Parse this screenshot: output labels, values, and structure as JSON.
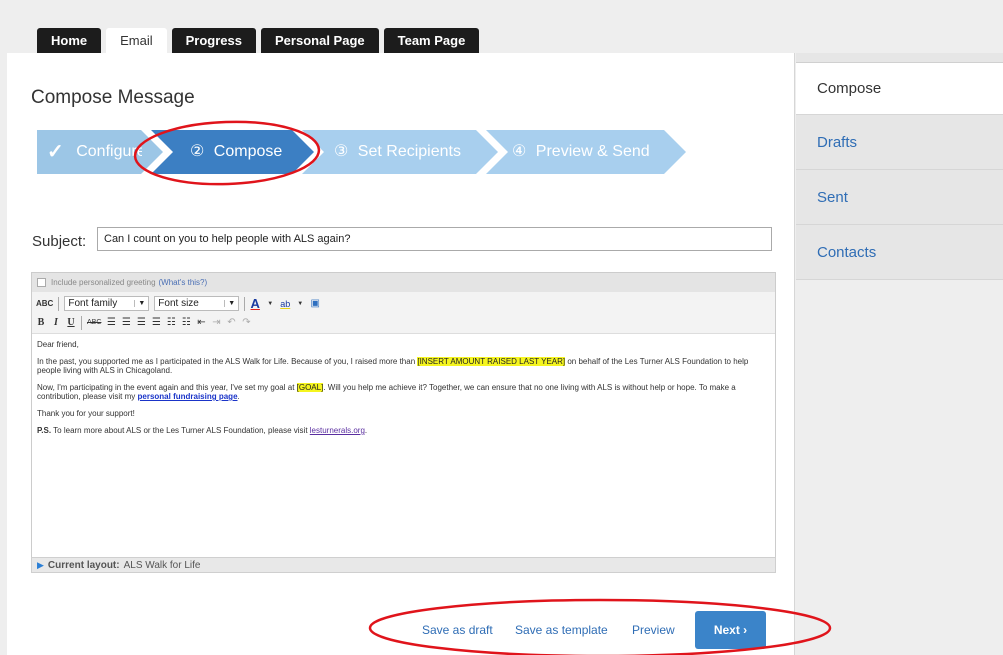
{
  "tabs": [
    {
      "label": "Home",
      "active": false
    },
    {
      "label": "Email",
      "active": true
    },
    {
      "label": "Progress",
      "active": false
    },
    {
      "label": "Personal Page",
      "active": false
    },
    {
      "label": "Team Page",
      "active": false
    }
  ],
  "main": {
    "title": "Compose Message",
    "steps": [
      {
        "label": "Configure",
        "marker": "✓",
        "state": "done"
      },
      {
        "label": "Compose",
        "marker": "②",
        "state": "current"
      },
      {
        "label": "Set Recipients",
        "marker": "③",
        "state": "upcoming"
      },
      {
        "label": "Preview & Send",
        "marker": "④",
        "state": "upcoming"
      }
    ],
    "subject_label": "Subject:",
    "subject_value": "Can I count on you to help people with ALS again?"
  },
  "editor": {
    "greeting_label": "Include personalized greeting",
    "greeting_link": "(What's this?)",
    "toolbar": {
      "font_family": "Font family",
      "font_size": "Font size"
    },
    "body": {
      "salutation": "Dear friend,",
      "p1_a": "In the past, you supported me as I participated in the ALS Walk for Life. Because of you, I raised more than ",
      "p1_highlight": "[INSERT AMOUNT RAISED LAST YEAR]",
      "p1_b": " on behalf of the Les Turner ALS Foundation to help people living with ALS in Chicagoland.",
      "p2_a": "Now, I'm participating in the event again and this year, I've set my goal at ",
      "p2_highlight": "[GOAL]",
      "p2_b": ". Will you help me achieve it? Together, we can ensure that no one living with ALS is without help or hope. To make a contribution, please visit my ",
      "p2_link": "personal fundraising page",
      "p2_c": ".",
      "thanks": "Thank you for your support!",
      "ps_label": "P.S.",
      "ps_text": " To learn more about ALS or the Les Turner ALS Foundation, please visit ",
      "ps_link": "lesturnerals.org",
      "ps_end": "."
    },
    "layout_label": "Current layout:",
    "layout_value": "ALS Walk for Life"
  },
  "actions": {
    "save_draft": "Save as draft",
    "save_template": "Save as template",
    "preview": "Preview",
    "next": "Next ›"
  },
  "sidebar": {
    "items": [
      {
        "label": "Compose",
        "active": true
      },
      {
        "label": "Drafts",
        "active": false
      },
      {
        "label": "Sent",
        "active": false
      },
      {
        "label": "Contacts",
        "active": false
      }
    ]
  },
  "colors": {
    "step_done": "#9cc6e6",
    "step_current": "#3c7fc3",
    "step_upcoming": "#a8cfee",
    "annotation": "#e0141b",
    "link": "#2f6db5"
  }
}
